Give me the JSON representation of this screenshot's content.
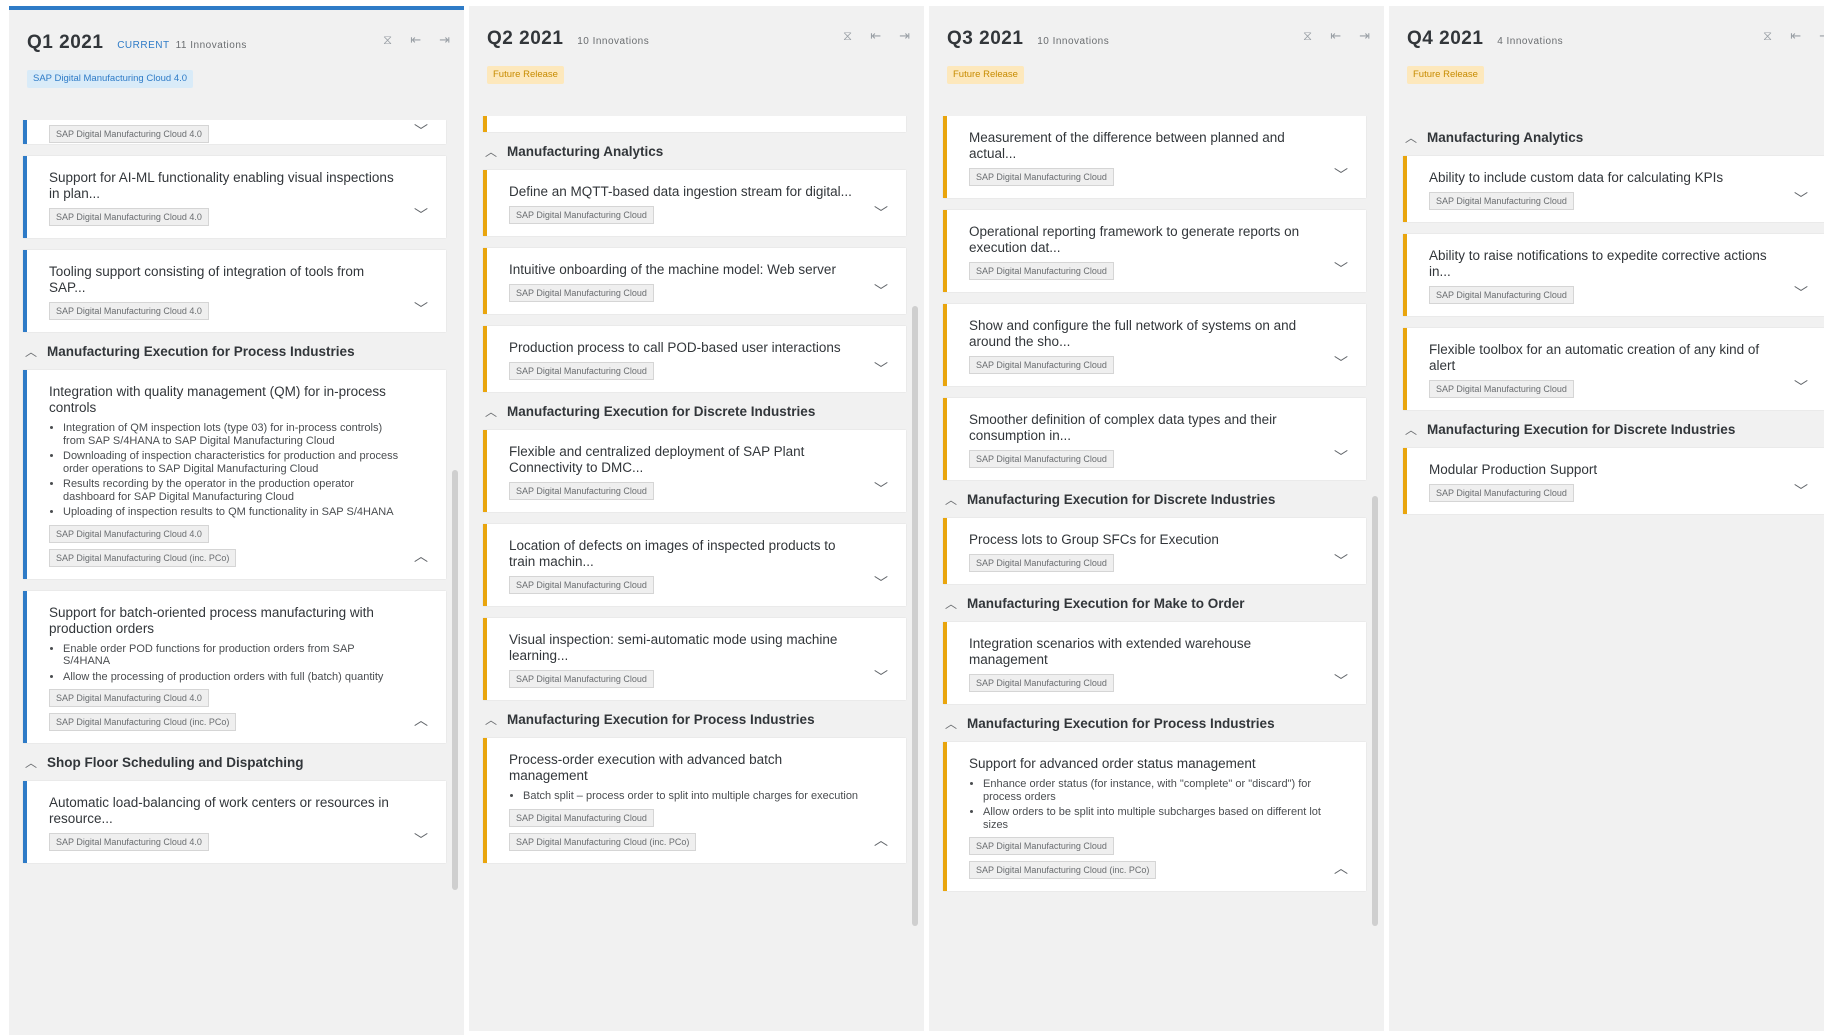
{
  "columns": [
    {
      "title": "Q1 2021",
      "current": "CURRENT",
      "count": "11 Innovations",
      "badge": "SAP Digital Manufacturing Cloud 4.0",
      "badge_color": "#2e7bc7",
      "items": [
        {
          "kind": "stub",
          "chip": "SAP Digital Manufacturing Cloud 4.0"
        },
        {
          "kind": "card",
          "title": "Support for AI-ML functionality enabling visual inspections in plan...",
          "chips": [
            "SAP Digital Manufacturing Cloud 4.0"
          ]
        },
        {
          "kind": "card",
          "title": "Tooling support consisting of integration of tools from SAP...",
          "chips": [
            "SAP Digital Manufacturing Cloud 4.0"
          ]
        },
        {
          "kind": "group",
          "title": "Manufacturing Execution for Process Industries"
        },
        {
          "kind": "card",
          "expanded": true,
          "title": "Integration with quality management (QM) for in-process controls",
          "bullets": [
            "Integration of QM inspection lots (type 03) for in-process controls) from SAP S/4HANA to SAP Digital Manufacturing Cloud",
            "Downloading of inspection characteristics for production and process order operations to SAP Digital Manufacturing Cloud",
            "Results recording by the operator in the production operator dashboard for SAP Digital Manufacturing Cloud",
            "Uploading of inspection results to QM functionality in SAP S/4HANA"
          ],
          "chips": [
            "SAP Digital Manufacturing Cloud 4.0",
            "SAP Digital Manufacturing Cloud (inc. PCo)"
          ]
        },
        {
          "kind": "card",
          "expanded": true,
          "title": "Support for batch-oriented process manufacturing with production orders",
          "bullets": [
            "Enable order POD functions for production orders from SAP S/4HANA",
            "Allow the processing of production orders with full (batch) quantity"
          ],
          "chips": [
            "SAP Digital Manufacturing Cloud 4.0",
            "SAP Digital Manufacturing Cloud (inc. PCo)"
          ]
        },
        {
          "kind": "group",
          "title": "Shop Floor Scheduling and Dispatching"
        },
        {
          "kind": "card",
          "title": "Automatic load-balancing of work centers or resources in resource...",
          "chips": [
            "SAP Digital Manufacturing Cloud 4.0"
          ]
        }
      ]
    },
    {
      "title": "Q2 2021",
      "count": "10 Innovations",
      "badge": "Future Release",
      "items": [
        {
          "kind": "stub",
          "chip": ""
        },
        {
          "kind": "group",
          "title": "Manufacturing Analytics"
        },
        {
          "kind": "card",
          "title": "Define an MQTT-based data ingestion stream for digital...",
          "chips": [
            "SAP Digital Manufacturing Cloud"
          ]
        },
        {
          "kind": "card",
          "title": "Intuitive onboarding of the machine model: Web server",
          "chips": [
            "SAP Digital Manufacturing Cloud"
          ]
        },
        {
          "kind": "card",
          "title": "Production process to call POD-based user interactions",
          "chips": [
            "SAP Digital Manufacturing Cloud"
          ]
        },
        {
          "kind": "group",
          "title": "Manufacturing Execution for Discrete Industries"
        },
        {
          "kind": "card",
          "title": "Flexible and centralized deployment of SAP Plant Connectivity to DMC...",
          "chips": [
            "SAP Digital Manufacturing Cloud"
          ]
        },
        {
          "kind": "card",
          "title": "Location of defects on images of inspected products to train machin...",
          "chips": [
            "SAP Digital Manufacturing Cloud"
          ]
        },
        {
          "kind": "card",
          "title": "Visual inspection: semi-automatic mode using machine learning...",
          "chips": [
            "SAP Digital Manufacturing Cloud"
          ]
        },
        {
          "kind": "group",
          "title": "Manufacturing Execution for Process Industries"
        },
        {
          "kind": "card",
          "expanded": true,
          "title": "Process-order execution with advanced batch management",
          "bullets": [
            "Batch split – process order to split into multiple charges for execution"
          ],
          "chips": [
            "SAP Digital Manufacturing Cloud",
            "SAP Digital Manufacturing Cloud (inc. PCo)"
          ]
        }
      ]
    },
    {
      "title": "Q3 2021",
      "count": "10 Innovations",
      "badge": "Future Release",
      "items": [
        {
          "kind": "card",
          "title": "Measurement of the difference between planned and actual...",
          "chips": [
            "SAP Digital Manufacturing Cloud"
          ]
        },
        {
          "kind": "card",
          "title": "Operational reporting framework to generate reports on execution dat...",
          "chips": [
            "SAP Digital Manufacturing Cloud"
          ]
        },
        {
          "kind": "card",
          "title": "Show and configure the full network of systems on and around the sho...",
          "chips": [
            "SAP Digital Manufacturing Cloud"
          ]
        },
        {
          "kind": "card",
          "title": "Smoother definition of complex data types and their consumption in...",
          "chips": [
            "SAP Digital Manufacturing Cloud"
          ]
        },
        {
          "kind": "group",
          "title": "Manufacturing Execution for Discrete Industries"
        },
        {
          "kind": "card",
          "title": "Process lots to Group SFCs for Execution",
          "chips": [
            "SAP Digital Manufacturing Cloud"
          ]
        },
        {
          "kind": "group",
          "title": "Manufacturing Execution for Make to Order"
        },
        {
          "kind": "card",
          "title": "Integration scenarios with extended warehouse management",
          "chips": [
            "SAP Digital Manufacturing Cloud"
          ]
        },
        {
          "kind": "group",
          "title": "Manufacturing Execution for Process Industries"
        },
        {
          "kind": "card",
          "expanded": true,
          "title": "Support for advanced order status management",
          "bullets": [
            "Enhance order status (for instance, with \"complete\" or \"discard\") for process orders",
            "Allow orders to be split into multiple subcharges based on different lot sizes"
          ],
          "chips": [
            "SAP Digital Manufacturing Cloud",
            "SAP Digital Manufacturing Cloud (inc. PCo)"
          ]
        }
      ]
    },
    {
      "title": "Q4 2021",
      "count": "4 Innovations",
      "badge": "Future Release",
      "items": [
        {
          "kind": "group",
          "title": "Manufacturing Analytics"
        },
        {
          "kind": "card",
          "title": "Ability to include custom data for calculating KPIs",
          "chips": [
            "SAP Digital Manufacturing Cloud"
          ]
        },
        {
          "kind": "card",
          "title": "Ability to raise notifications to expedite corrective actions in...",
          "chips": [
            "SAP Digital Manufacturing Cloud"
          ]
        },
        {
          "kind": "card",
          "title": "Flexible toolbox for an automatic creation of any kind of alert",
          "chips": [
            "SAP Digital Manufacturing Cloud"
          ]
        },
        {
          "kind": "group",
          "title": "Manufacturing Execution for Discrete Industries"
        },
        {
          "kind": "card",
          "title": "Modular Production Support",
          "chips": [
            "SAP Digital Manufacturing Cloud"
          ]
        }
      ]
    }
  ],
  "icons": {
    "filter": "filter-icon",
    "collapse": "collapse-left-icon",
    "expand": "expand-right-icon",
    "chevron_down": "chevron-down-icon",
    "chevron_up": "chevron-up-icon"
  },
  "colors": {
    "current_accent": "#2e7bc7",
    "future_accent": "#e9a50d",
    "future_badge_bg": "#fde8bc"
  }
}
